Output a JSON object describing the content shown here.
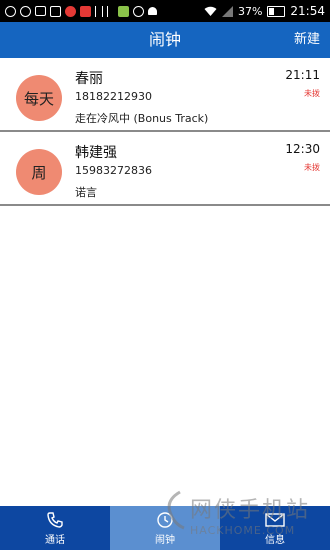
{
  "status_bar": {
    "battery": "37%",
    "time": "21:54",
    "icon_colors": [
      "#ffffff",
      "#ffffff",
      "#ffffff",
      "#ffffff",
      "#e53935",
      "#e53935",
      "#ffffff",
      "#ffffff",
      "#ffffff",
      "#8bc34a",
      "#ffffff"
    ]
  },
  "header": {
    "title": "闹钟",
    "new_label": "新建"
  },
  "alarms": [
    {
      "repeat": "每天",
      "name": "春丽",
      "phone": "18182212930",
      "song": "走在冷风中 (Bonus Track)",
      "time": "21:11",
      "status": "未拨"
    },
    {
      "repeat": "周",
      "name": "韩建强",
      "phone": "15983272836",
      "song": "诺言",
      "time": "12:30",
      "status": "未拨"
    }
  ],
  "tabs": [
    {
      "label": "通话",
      "icon": "phone-icon"
    },
    {
      "label": "闹钟",
      "icon": "clock-icon",
      "active": true
    },
    {
      "label": "信息",
      "icon": "envelope-icon"
    }
  ],
  "watermark": {
    "main": "网侠手机站",
    "sub": "HACKHOME.COM"
  },
  "colors": {
    "appbar": "#1565c0",
    "tabbar": "#0d47a1",
    "active_tab": "#5b8fd0",
    "avatar": "#ef8a72",
    "status_text": "#e53935"
  }
}
